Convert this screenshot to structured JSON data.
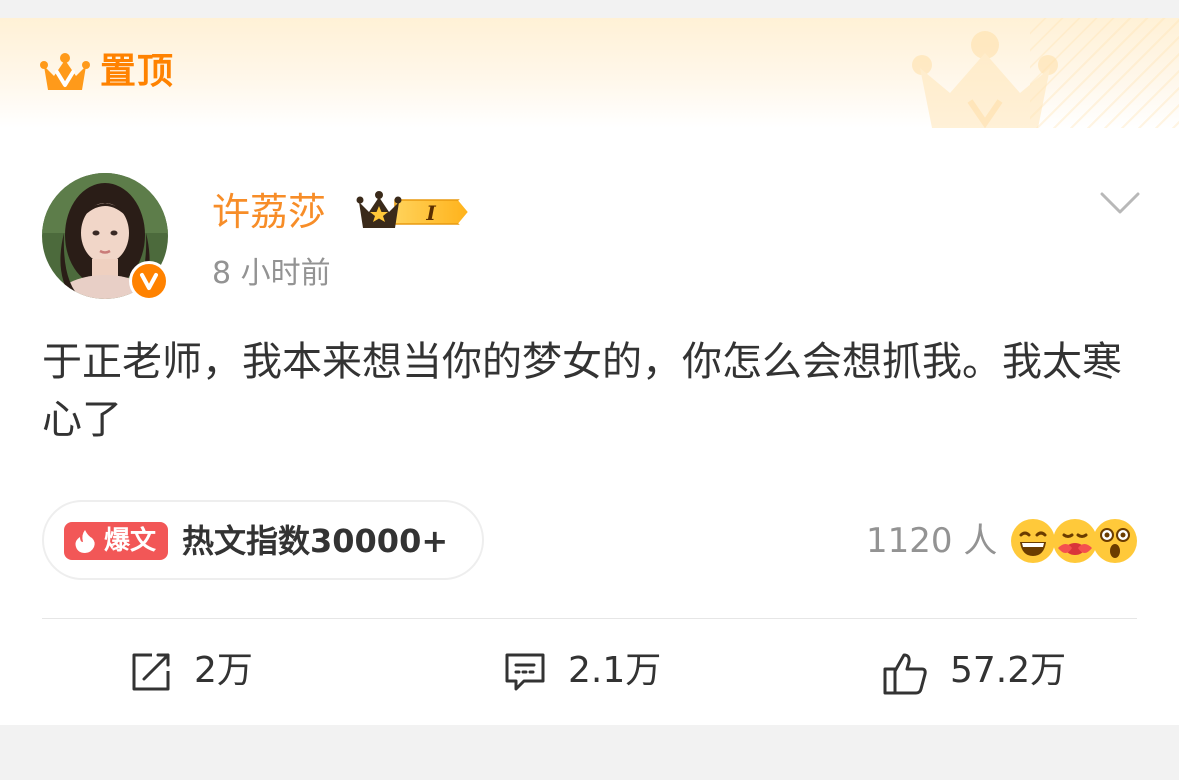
{
  "banner": {
    "label": "置顶",
    "pin_icon": "vip-crown-icon"
  },
  "author": {
    "name": "许荔莎",
    "time": "8 小时前",
    "vip_level": "I",
    "avatar_icon": "avatar",
    "verify_icon": "verified-v-icon"
  },
  "post": {
    "text": "于正老师，我本来想当你的梦女的，你怎么会想抓我。我太寒心了"
  },
  "hot": {
    "tag": "爆文",
    "text": "热文指数30000+"
  },
  "reactions": {
    "count": "1120 人",
    "emojis": [
      "grin-emoji",
      "hug-emoji",
      "shock-emoji"
    ]
  },
  "actions": {
    "repost": "2万",
    "comment": "2.1万",
    "like": "57.2万"
  },
  "colors": {
    "accent": "#ff8200",
    "username": "#f78d28",
    "hot_tag": "#f25757",
    "muted": "#939393"
  }
}
